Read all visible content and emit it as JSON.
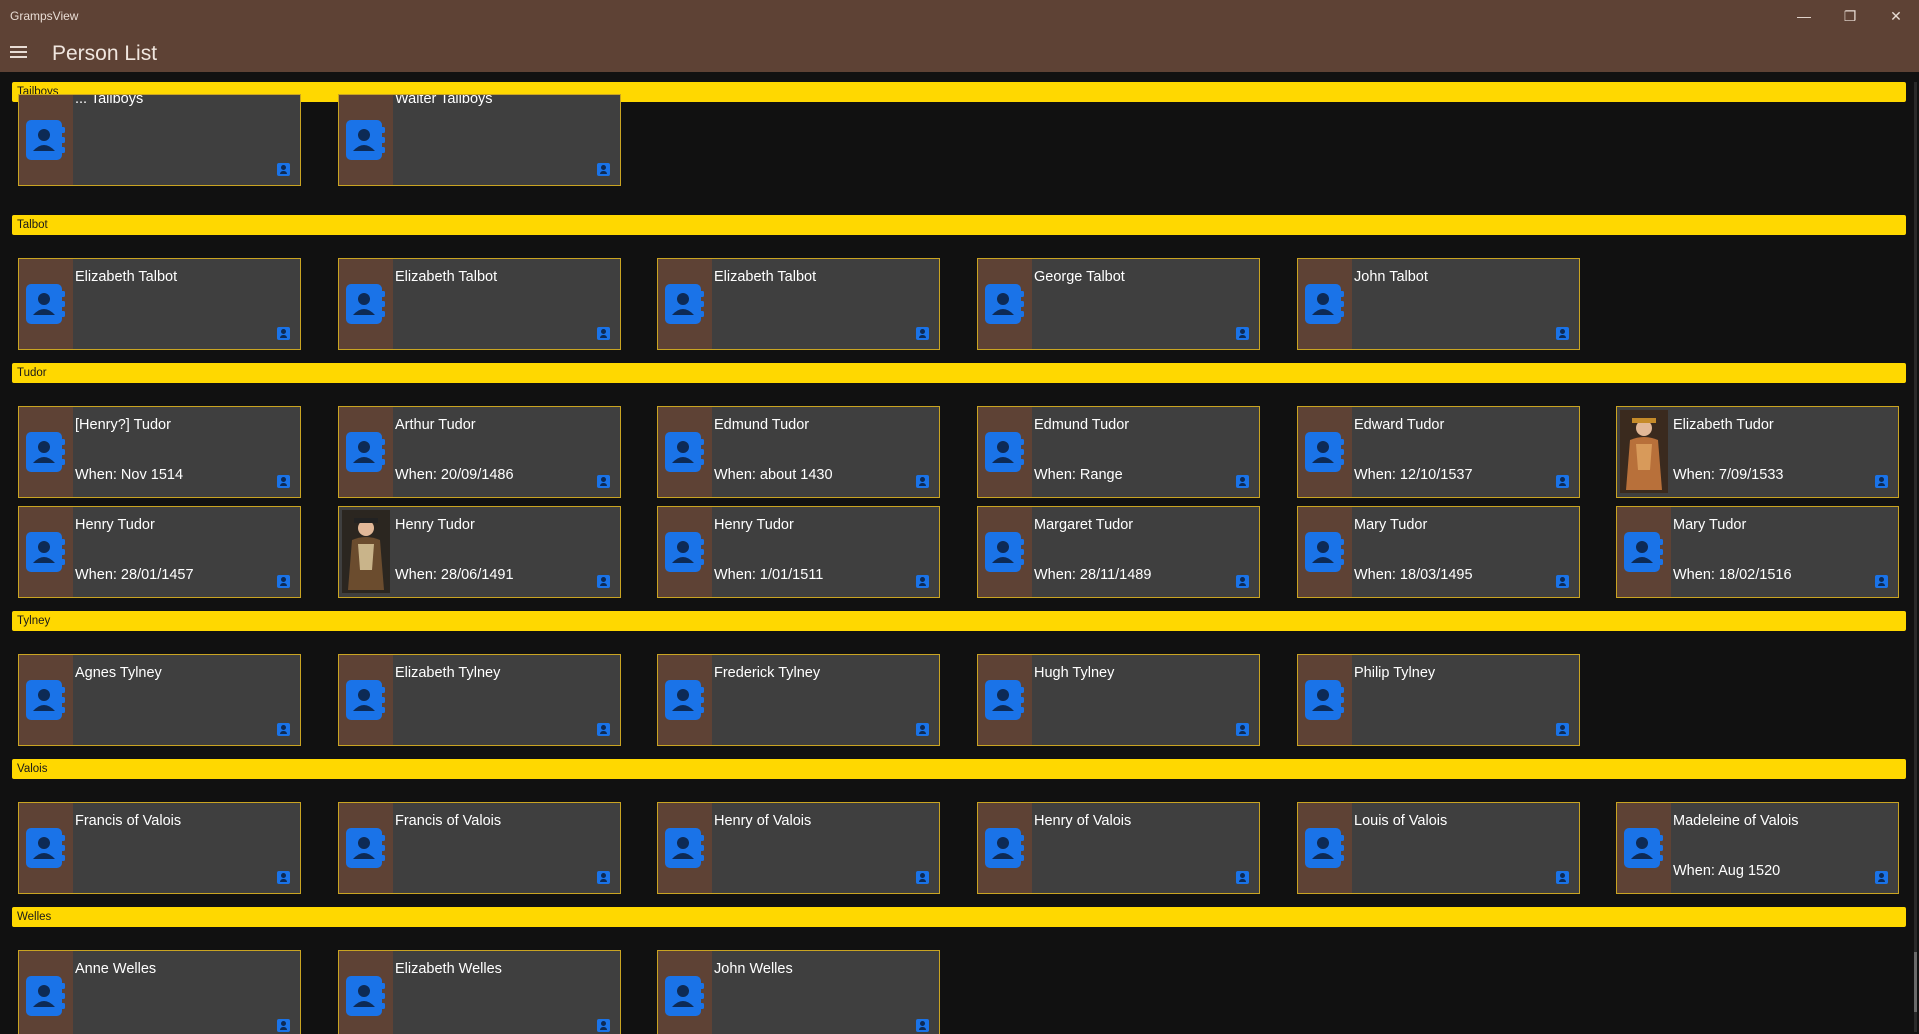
{
  "window": {
    "title": "GrampsView",
    "minimize": "—",
    "restore": "❐",
    "close": "✕"
  },
  "header": {
    "title": "Person List"
  },
  "colors": {
    "titlebar": "#5e4235",
    "group_header": "#ffd800",
    "card_bg": "#3f3f3f",
    "card_border": "#c9a422",
    "icon_blue": "#1a73e8"
  },
  "groups": [
    {
      "surname": "Tailboys",
      "persons": [
        {
          "name": "... Tailboys",
          "when": "",
          "icon": "contact-book-icon"
        },
        {
          "name": "Walter Tailboys",
          "when": "",
          "icon": "contact-book-icon"
        }
      ]
    },
    {
      "surname": "Talbot",
      "persons": [
        {
          "name": "Elizabeth Talbot",
          "when": "",
          "icon": "contact-book-icon"
        },
        {
          "name": "Elizabeth Talbot",
          "when": "",
          "icon": "contact-book-icon"
        },
        {
          "name": "Elizabeth Talbot",
          "when": "",
          "icon": "contact-book-icon"
        },
        {
          "name": "George Talbot",
          "when": "",
          "icon": "contact-book-icon"
        },
        {
          "name": "John Talbot",
          "when": "",
          "icon": "contact-book-icon"
        }
      ]
    },
    {
      "surname": "Tudor",
      "persons": [
        {
          "name": "[Henry?] Tudor",
          "when": "When: Nov 1514",
          "icon": "contact-book-icon"
        },
        {
          "name": "Arthur Tudor",
          "when": "When: 20/09/1486",
          "icon": "contact-book-icon"
        },
        {
          "name": "Edmund Tudor",
          "when": "When: about 1430",
          "icon": "contact-book-icon"
        },
        {
          "name": "Edmund Tudor",
          "when": "When: Range",
          "icon": "contact-book-icon"
        },
        {
          "name": "Edward Tudor",
          "when": "When: 12/10/1537",
          "icon": "contact-book-icon"
        },
        {
          "name": "Elizabeth Tudor",
          "when": "When: 7/09/1533",
          "icon": "portrait-image"
        },
        {
          "name": "Henry Tudor",
          "when": "When: 28/01/1457",
          "icon": "contact-book-icon"
        },
        {
          "name": "Henry Tudor",
          "when": "When: 28/06/1491",
          "icon": "portrait-image"
        },
        {
          "name": "Henry Tudor",
          "when": "When: 1/01/1511",
          "icon": "contact-book-icon"
        },
        {
          "name": "Margaret Tudor",
          "when": "When: 28/11/1489",
          "icon": "contact-book-icon"
        },
        {
          "name": "Mary Tudor",
          "when": "When: 18/03/1495",
          "icon": "contact-book-icon"
        },
        {
          "name": "Mary Tudor",
          "when": "When: 18/02/1516",
          "icon": "contact-book-icon"
        }
      ]
    },
    {
      "surname": "Tylney",
      "persons": [
        {
          "name": "Agnes Tylney",
          "when": "",
          "icon": "contact-book-icon"
        },
        {
          "name": "Elizabeth Tylney",
          "when": "",
          "icon": "contact-book-icon"
        },
        {
          "name": "Frederick Tylney",
          "when": "",
          "icon": "contact-book-icon"
        },
        {
          "name": "Hugh Tylney",
          "when": "",
          "icon": "contact-book-icon"
        },
        {
          "name": "Philip Tylney",
          "when": "",
          "icon": "contact-book-icon"
        }
      ]
    },
    {
      "surname": "Valois",
      "persons": [
        {
          "name": "Francis of Valois",
          "when": "",
          "icon": "contact-book-icon"
        },
        {
          "name": "Francis of Valois",
          "when": "",
          "icon": "contact-book-icon"
        },
        {
          "name": "Henry of Valois",
          "when": "",
          "icon": "contact-book-icon"
        },
        {
          "name": "Henry of Valois",
          "when": "",
          "icon": "contact-book-icon"
        },
        {
          "name": "Louis of Valois",
          "when": "",
          "icon": "contact-book-icon"
        },
        {
          "name": "Madeleine of Valois",
          "when": "When: Aug 1520",
          "icon": "contact-book-icon"
        }
      ]
    },
    {
      "surname": "Welles",
      "persons": [
        {
          "name": "Anne Welles",
          "when": "",
          "icon": "contact-book-icon"
        },
        {
          "name": "Elizabeth Welles",
          "when": "",
          "icon": "contact-book-icon"
        },
        {
          "name": "John Welles",
          "when": "",
          "icon": "contact-book-icon"
        }
      ]
    }
  ]
}
